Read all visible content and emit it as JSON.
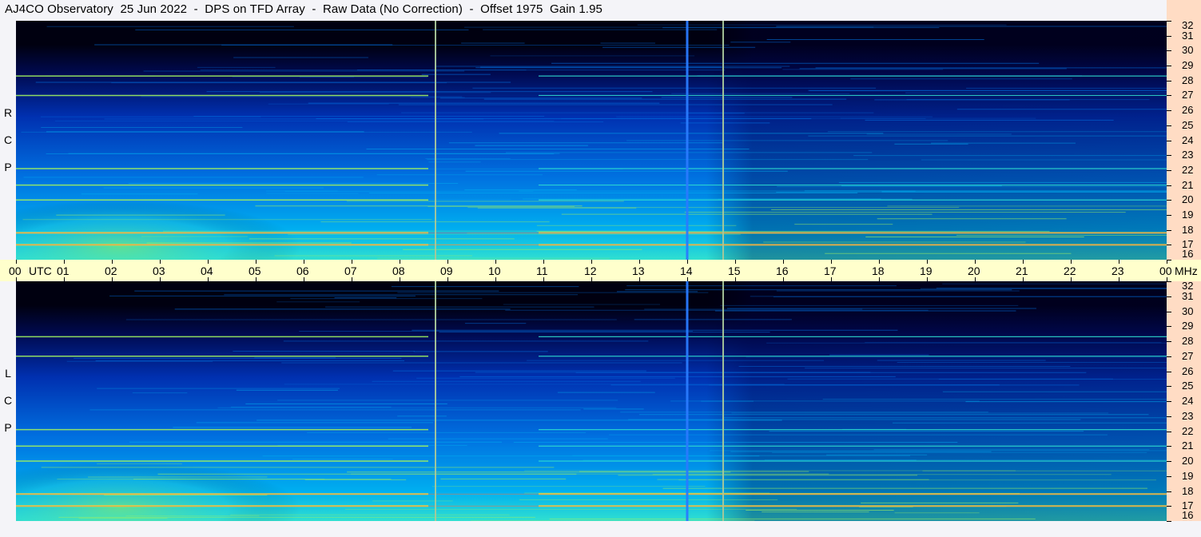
{
  "title": "AJ4CO Observatory  25 Jun 2022  -  DPS on TFD Array  -  Raw Data (No Correction)  -  Offset 1975  Gain 1.95",
  "chart_data": [
    {
      "type": "heatmap",
      "name": "RCP",
      "polarization_label": [
        "R",
        "C",
        "P"
      ],
      "x_axis": {
        "unit": "UTC",
        "range": [
          0,
          24
        ],
        "ticks": [
          "00",
          "01",
          "02",
          "03",
          "04",
          "05",
          "06",
          "07",
          "08",
          "09",
          "10",
          "11",
          "12",
          "13",
          "14",
          "15",
          "16",
          "17",
          "18",
          "19",
          "20",
          "21",
          "22",
          "23",
          "00"
        ]
      },
      "y_axis": {
        "unit": "MHz",
        "range": [
          16,
          32
        ],
        "ticks": [
          16,
          17,
          18,
          19,
          20,
          21,
          22,
          23,
          24,
          25,
          26,
          27,
          28,
          29,
          30,
          31,
          32
        ]
      },
      "colormap": [
        "#000010",
        "#000a50",
        "#0030b0",
        "#0070e0",
        "#00b0f0",
        "#30e0d0",
        "#a0f060",
        "#f0e040",
        "#ff7040"
      ],
      "features": {
        "vertical_lines_utc": [
          8.75,
          14.0,
          14.75
        ],
        "strong_bands_mhz": [
          17.0,
          17.8,
          20.0,
          21.0,
          22.1,
          27.0,
          28.3
        ]
      }
    },
    {
      "type": "heatmap",
      "name": "LCP",
      "polarization_label": [
        "L",
        "C",
        "P"
      ],
      "x_axis": {
        "unit": "UTC",
        "range": [
          0,
          24
        ]
      },
      "y_axis": {
        "unit": "MHz",
        "range": [
          16,
          32
        ],
        "ticks": [
          16,
          17,
          18,
          19,
          20,
          21,
          22,
          23,
          24,
          25,
          26,
          27,
          28,
          29,
          30,
          31,
          32
        ]
      },
      "colormap": [
        "#000010",
        "#000a50",
        "#0030b0",
        "#0070e0",
        "#00b0f0",
        "#30e0d0",
        "#a0f060",
        "#f0e040",
        "#ff7040"
      ],
      "features": {
        "vertical_lines_utc": [
          8.75,
          14.0,
          14.75
        ],
        "strong_bands_mhz": [
          17.0,
          17.8,
          20.0,
          21.0,
          22.1,
          27.0,
          28.3
        ]
      }
    }
  ],
  "time_axis_labels": [
    "00",
    "UTC",
    "01",
    "02",
    "03",
    "04",
    "05",
    "06",
    "07",
    "08",
    "09",
    "10",
    "11",
    "12",
    "13",
    "14",
    "15",
    "16",
    "17",
    "18",
    "19",
    "20",
    "21",
    "22",
    "23",
    "00",
    "MHz"
  ]
}
